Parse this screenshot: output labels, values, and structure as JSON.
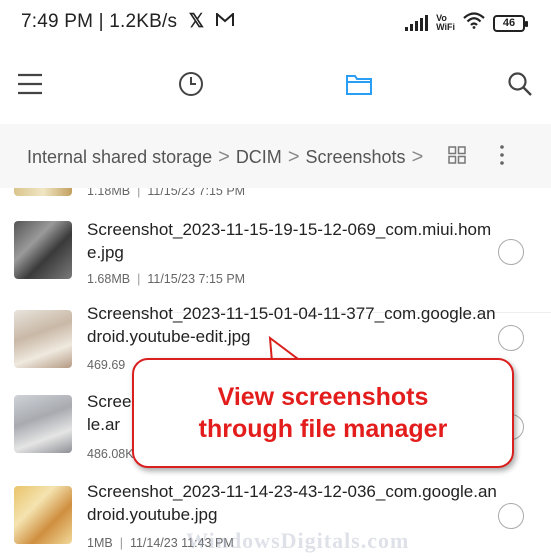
{
  "status": {
    "time_speed": "7:49 PM | 1.2KB/s",
    "x_logo": "𝕏",
    "mail_glyph": "M",
    "vowifi_line1": "Vo",
    "vowifi_line2": "WiFi",
    "battery": "46"
  },
  "nav": {
    "icons": [
      "menu-icon",
      "clock-icon",
      "folder-icon",
      "search-icon"
    ],
    "active_color": "#2a9df4"
  },
  "breadcrumb": {
    "items": [
      "Internal shared storage",
      "DCIM",
      "Screenshots"
    ],
    "separator": ">"
  },
  "files": [
    {
      "name": "",
      "size": "1.18MB",
      "date": "11/15/23 7:15 PM"
    },
    {
      "name": "Screenshot_2023-11-15-19-15-12-069_com.miui.home.jpg",
      "size": "1.68MB",
      "date": "11/15/23 7:15 PM"
    },
    {
      "name": "Screenshot_2023-11-15-01-04-11-377_com.google.android.youtube-edit.jpg",
      "size": "469.69",
      "date": ""
    },
    {
      "name": "Scree gle.ar",
      "size": "486.08K",
      "date": ""
    },
    {
      "name": "Screenshot_2023-11-14-23-43-12-036_com.google.android.youtube.jpg",
      "size": "1MB",
      "date": "11/14/23 11:43 PM"
    }
  ],
  "callout": {
    "line1": "View screenshots",
    "line2": "through file manager",
    "color": "#e31c1c"
  },
  "watermark": "WindowsDigitals.com"
}
